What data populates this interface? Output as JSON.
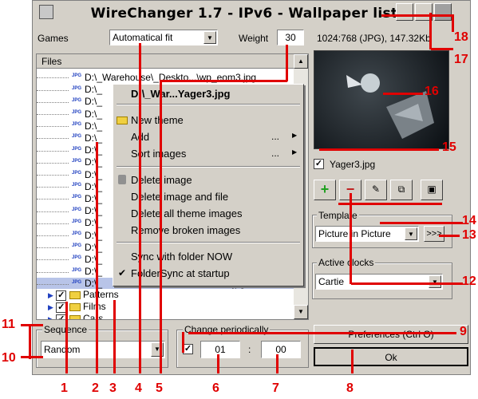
{
  "app": {
    "title": "WireChanger 1.7 - IPv6 - Wallpaper list"
  },
  "top": {
    "group_label": "Games",
    "fit_value": "Automatical fit",
    "weight_label": "Weight",
    "weight_value": "30",
    "image_info": "1024:768 (JPG), 147.32Kb"
  },
  "list": {
    "header": "Files",
    "first_item": "D:\\_Warehouse\\_Deskto...\\wp_eom3.jpg",
    "items_prefix": "D:\\_",
    "selected_tail": ".jpg",
    "folders": [
      "Patterns",
      "Films",
      "Cars"
    ]
  },
  "menu": {
    "title": "D:\\_War...Yager3.jpg",
    "items": [
      "New theme",
      "Add",
      "Sort images",
      "Delete image",
      "Delete image and file",
      "Delete all theme images",
      "Remove broken images",
      "Sync with folder NOW",
      "FolderSync at startup"
    ],
    "ellipsis": "..."
  },
  "preview": {
    "filename": "Yager3.jpg"
  },
  "template": {
    "label": "Template",
    "value": "Picture in Picture",
    "more": ">>>"
  },
  "clocks": {
    "label": "Active clocks",
    "value": "Cartie"
  },
  "sequence": {
    "label": "Sequence",
    "value": "Random"
  },
  "change": {
    "label": "Change periodically",
    "hours": "01",
    "sep": ":",
    "minutes": "00"
  },
  "buttons": {
    "preferences": "Preferences (Ctrl O)",
    "ok": "Ok"
  },
  "callouts": [
    "1",
    "2",
    "3",
    "4",
    "5",
    "6",
    "7",
    "8",
    "9",
    "10",
    "11",
    "12",
    "13",
    "14",
    "15",
    "16",
    "17",
    "18"
  ],
  "colors": {
    "callout": "#e00000",
    "window": "#d4d0c8",
    "selection": "#b8c4e8"
  }
}
